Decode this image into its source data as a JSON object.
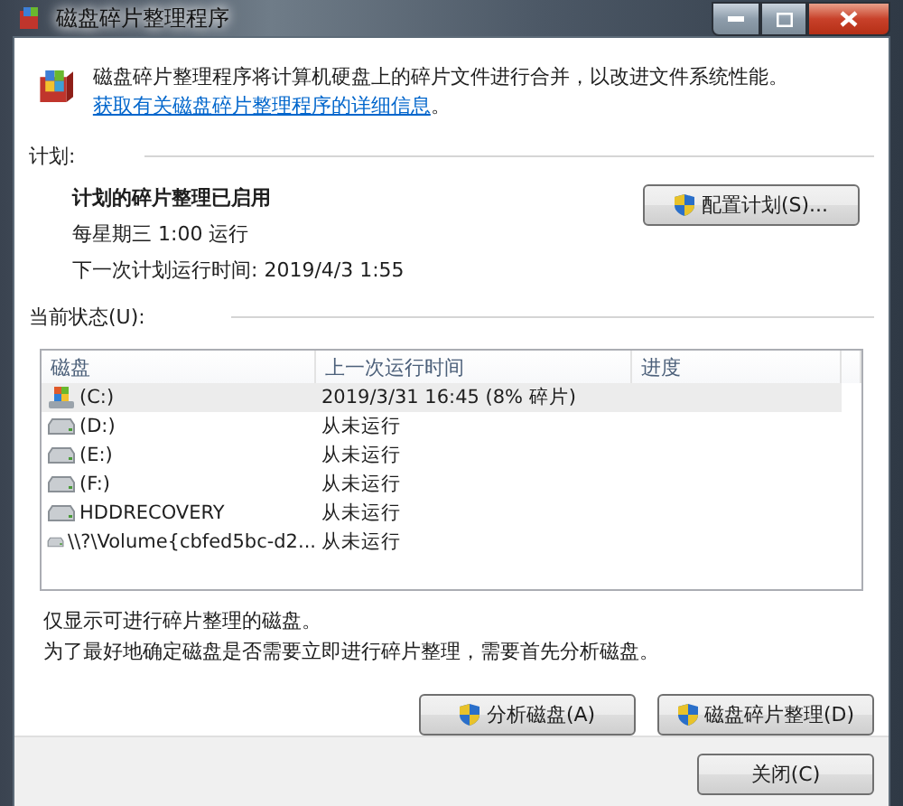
{
  "window": {
    "title": "磁盘碎片整理程序"
  },
  "intro": {
    "text": "磁盘碎片整理程序将计算机硬盘上的碎片文件进行合并，以改进文件系统性能。",
    "link": "获取有关磁盘碎片整理程序的详细信息",
    "after": "。"
  },
  "schedule": {
    "label": "计划:",
    "status": "计划的碎片整理已启用",
    "frequency": "每星期三  1:00 运行",
    "next_run": "下一次计划运行时间: 2019/4/3 1:55",
    "button": "配置计划(S)..."
  },
  "current_status": {
    "label": "当前状态(U):",
    "columns": [
      "磁盘",
      "上一次运行时间",
      "进度"
    ],
    "rows": [
      {
        "kind": "system",
        "disk": "(C:)",
        "last_run": "2019/3/31 16:45 (8% 碎片)",
        "selected": true
      },
      {
        "kind": "drive",
        "disk": "(D:)",
        "last_run": "从未运行",
        "selected": false
      },
      {
        "kind": "drive",
        "disk": "(E:)",
        "last_run": "从未运行",
        "selected": false
      },
      {
        "kind": "drive",
        "disk": "(F:)",
        "last_run": "从未运行",
        "selected": false
      },
      {
        "kind": "drive",
        "disk": "HDDRECOVERY",
        "last_run": "从未运行",
        "selected": false
      },
      {
        "kind": "drive",
        "disk": "\\\\?\\Volume{cbfed5bc-d2...",
        "last_run": "从未运行",
        "selected": false
      }
    ]
  },
  "notes": [
    "仅显示可进行碎片整理的磁盘。",
    "为了最好地确定磁盘是否需要立即进行碎片整理，需要首先分析磁盘。"
  ],
  "actions": [
    "分析磁盘(A)",
    "磁盘碎片整理(D)"
  ],
  "close_button": "关闭(C)"
}
